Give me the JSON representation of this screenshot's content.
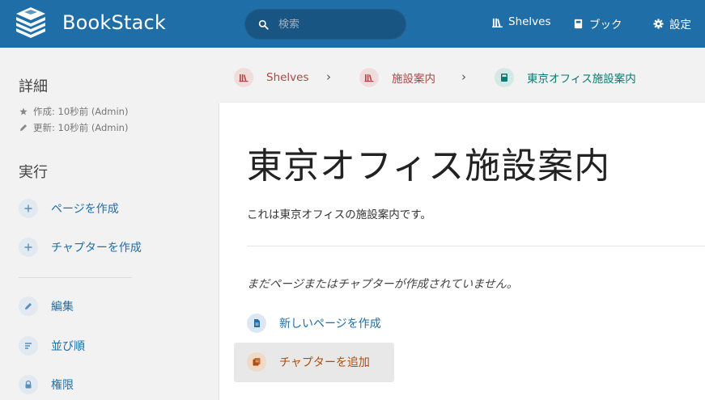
{
  "header": {
    "brand": "BookStack",
    "search_placeholder": "検索",
    "nav": {
      "shelves": "Shelves",
      "books": "ブック",
      "settings": "設定"
    }
  },
  "sidebar": {
    "details_title": "詳細",
    "created": "作成: 10秒前 (Admin)",
    "updated": "更新: 10秒前 (Admin)",
    "actions_title": "実行",
    "create_page": "ページを作成",
    "create_chapter": "チャプターを作成",
    "edit": "編集",
    "sort": "並び順",
    "permissions": "権限"
  },
  "breadcrumb": {
    "shelves": "Shelves",
    "shelf": "施設案内",
    "book": "東京オフィス施設案内"
  },
  "content": {
    "title": "東京オフィス施設案内",
    "description": "これは東京オフィスの施設案内です。",
    "empty_message": "まだページまたはチャプターが作成されていません。",
    "new_page": "新しいページを作成",
    "add_chapter": "チャプターを追加"
  },
  "colors": {
    "header": "#206ea7",
    "primary": "#206ea7",
    "shelf": "#a94747",
    "book": "#077b70",
    "chapter": "#af4d0d",
    "page": "#206ea7"
  }
}
